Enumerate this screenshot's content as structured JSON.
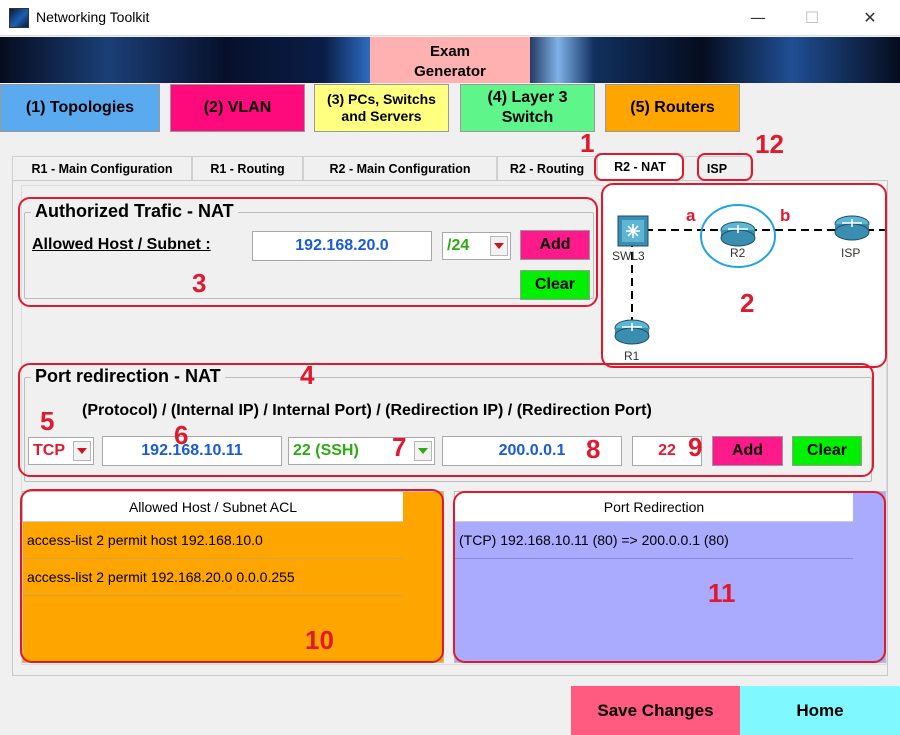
{
  "window": {
    "title": "Networking Toolkit",
    "minimize": "—",
    "maximize": "☐",
    "close": "✕"
  },
  "banner": {
    "exam_label_1": "Exam",
    "exam_label_2": "Generator"
  },
  "nav": {
    "topologies": "(1) Topologies",
    "vlan": "(2) VLAN",
    "pcs_1": "(3) PCs, Switchs",
    "pcs_2": "and Servers",
    "layer3_1": "(4) Layer 3",
    "layer3_2": "Switch",
    "routers": "(5) Routers"
  },
  "tabs": [
    "R1 - Main Configuration",
    "R1 - Routing",
    "R2 - Main Configuration",
    "R2 - Routing",
    "R2 - NAT",
    "ISP"
  ],
  "active_tab": "R2 - NAT",
  "authorized": {
    "title": "Authorized Trafic - NAT",
    "host_label": "Allowed Host / Subnet :",
    "host_value": "192.168.20.0",
    "mask_value": "/24",
    "add": "Add",
    "clear": "Clear"
  },
  "topology": {
    "nodes": {
      "swl3": "SWL3",
      "r2": "R2",
      "isp": "ISP",
      "r1": "R1"
    },
    "link_a": "a",
    "link_b": "b"
  },
  "port_redirection": {
    "title": "Port redirection - NAT",
    "header": "(Protocol) / (Internal IP) / Internal Port) / (Redirection IP) / (Redirection Port)",
    "protocol": "TCP",
    "internal_ip": "192.168.10.11",
    "internal_port": "22 (SSH)",
    "redirection_ip": "200.0.0.1",
    "redirection_port": "22",
    "add": "Add",
    "clear": "Clear"
  },
  "acl_list": {
    "header": "Allowed Host / Subnet ACL",
    "rows": [
      "access-list 2 permit host 192.168.10.0",
      "access-list 2 permit 192.168.20.0 0.0.0.255"
    ]
  },
  "redir_list": {
    "header": "Port Redirection",
    "rows": [
      "(TCP) 192.168.10.11 (80) => 200.0.0.1 (80)"
    ]
  },
  "annotations": [
    "1",
    "2",
    "3",
    "4",
    "5",
    "6",
    "7",
    "8",
    "9",
    "10",
    "11",
    "12"
  ],
  "footer": {
    "save": "Save Changes",
    "home": "Home"
  },
  "colors": {
    "accent_red": "#e01a2e",
    "topologies": "#5aaaf0",
    "vlan": "#ff0a7d",
    "pcs": "#ffff80",
    "layer3": "#5ef58a",
    "routers": "#ffa500",
    "add_btn": "#ff1a8c",
    "clear_btn": "#00f000",
    "acl_bg": "#ffa500",
    "redir_bg": "#aaaaff",
    "save": "#ff5a80",
    "home": "#7ff9ff"
  }
}
